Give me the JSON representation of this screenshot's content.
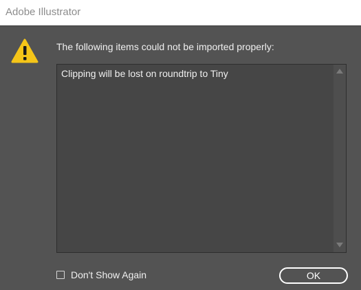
{
  "window": {
    "title": "Adobe Illustrator"
  },
  "dialog": {
    "icon": "warning-triangle-icon",
    "icon_color": "#f5c518",
    "message": "The following items could not be imported properly:",
    "items": [
      "Clipping will be lost on roundtrip to Tiny"
    ],
    "checkbox": {
      "label": "Don't Show Again",
      "checked": false
    },
    "ok_label": "OK"
  },
  "colors": {
    "background": "#535353",
    "list_background": "#464646",
    "text": "#f0f0f0"
  }
}
